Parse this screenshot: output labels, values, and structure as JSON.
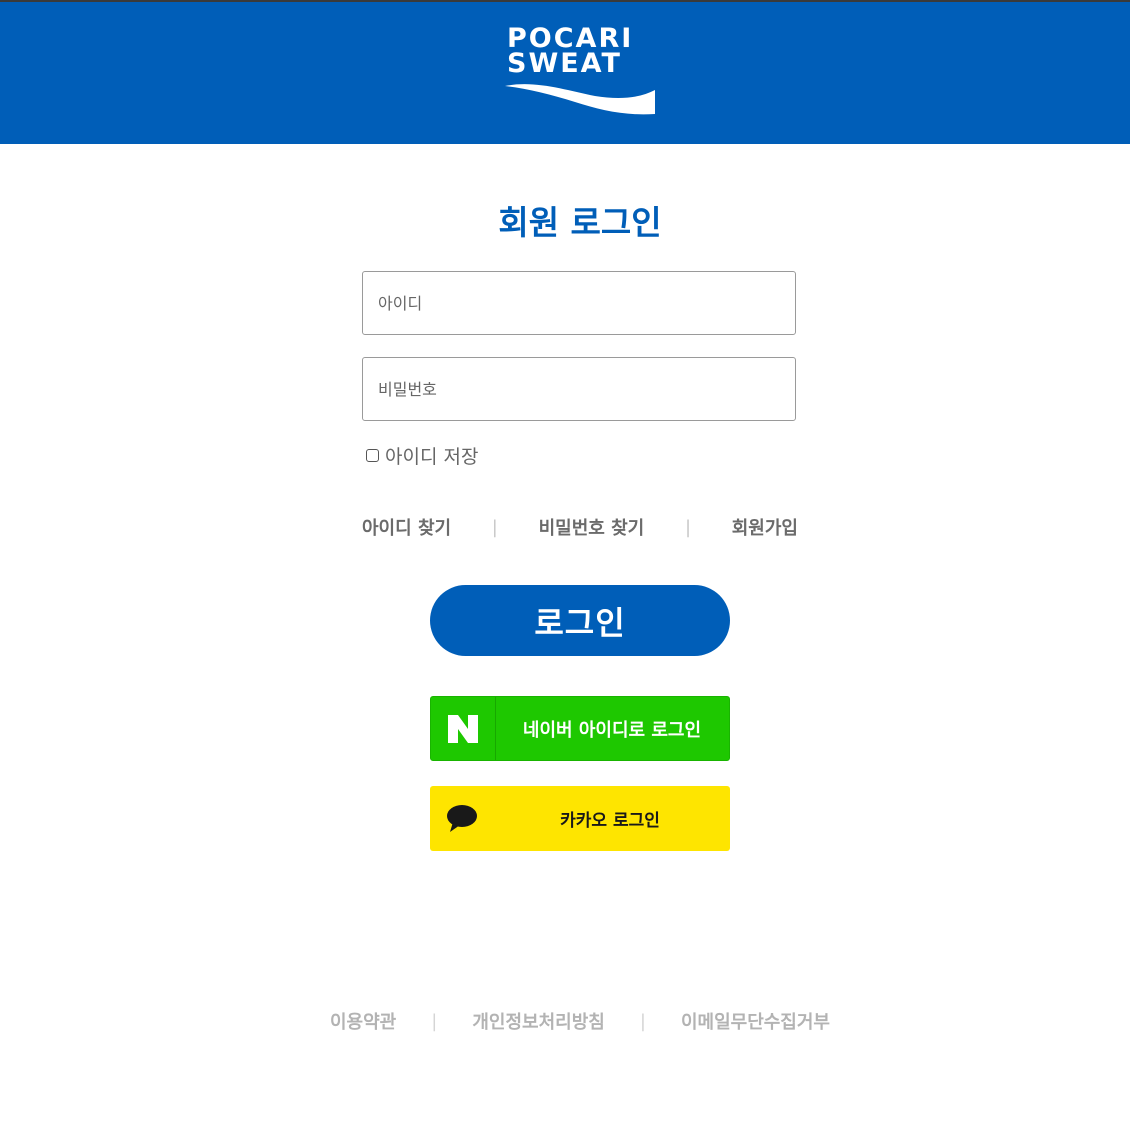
{
  "brand": {
    "logo_line1": "POCARI",
    "logo_line2": "SWEAT",
    "primary_color": "#005eb8"
  },
  "login_form": {
    "title": "회원 로그인",
    "id_placeholder": "아이디",
    "password_placeholder": "비밀번호",
    "save_id_label": "아이디 저장",
    "save_id_checked": false,
    "submit_label": "로그인"
  },
  "account_links": {
    "find_id": "아이디 찾기",
    "find_password": "비밀번호 찾기",
    "signup": "회원가입",
    "separator": "|"
  },
  "social_login": {
    "naver": {
      "label": "네이버 아이디로 로그인",
      "icon": "naver-n-logo",
      "color": "#1ec800"
    },
    "kakao": {
      "label": "카카오 로그인",
      "icon": "kakao-speech-bubble",
      "color": "#fee500"
    }
  },
  "footer": {
    "terms": "이용약관",
    "privacy": "개인정보처리방침",
    "email_refusal": "이메일무단수집거부",
    "separator": "|"
  }
}
